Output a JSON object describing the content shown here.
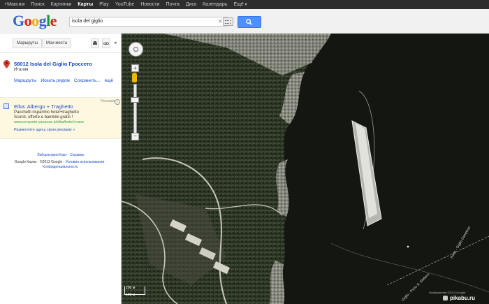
{
  "gbar": {
    "items": [
      "+Максим",
      "Поиск",
      "Картинки",
      "Карты",
      "Play",
      "YouTube",
      "Новости",
      "Почта",
      "Диск",
      "Календарь",
      "Ещё"
    ],
    "active_index": 3
  },
  "logo": {
    "text": "Google"
  },
  "search": {
    "value": "isola del giglio"
  },
  "sidebar": {
    "routes_label": "Маршруты",
    "places_label": "Мои места",
    "result": {
      "title": "58012 Isola del Giglio Гроссето",
      "subtitle": "Италия",
      "actions": [
        "Маршруты",
        "Искать рядом",
        "Сохранить...",
        "ещё"
      ]
    },
    "ad": {
      "tag": "Реклама",
      "title": "Elba: Albergo + Traghetto",
      "line1": "Pacchetti risparmio hotel+traghetto",
      "line2": "Sconti, offerte e bambini gratis !",
      "url": "www.emporio-vacanze.it/elba/hotel+nave",
      "promo": "Разместите здесь свою рекламу »"
    },
    "footer": {
      "lab": "Лаборатория Карт",
      "help": "Справка",
      "copyright": "Google Карты - ©2013 Google -",
      "terms": "Условия использования",
      "privacy": "Конфиденциальность"
    }
  },
  "map": {
    "scale_top": "200 м",
    "scale_bottom": "100 м",
    "road_label": "Porto - Giglio Campese",
    "route_label": "Giglio - Porto S. Stefano",
    "credit": "Изображения ©2013 Google",
    "watermark": "pikabu.ru"
  }
}
